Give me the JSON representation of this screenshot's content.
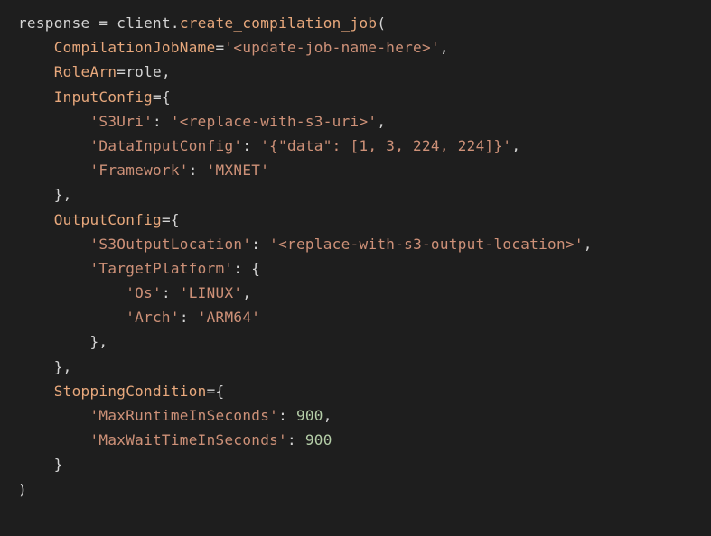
{
  "tokens": {
    "l1_var": "response ",
    "l1_eq": "= ",
    "l1_obj": "client",
    "l1_dot": ".",
    "l1_func": "create_compilation_job",
    "l1_paren": "(",
    "l2_indent": "    ",
    "l2_param": "CompilationJobName",
    "l2_eq": "=",
    "l2_val": "'<update-job-name-here>'",
    "l2_comma": ",",
    "l3_indent": "    ",
    "l3_param": "RoleArn",
    "l3_eq": "=",
    "l3_val": "role",
    "l3_comma": ",",
    "l4_indent": "    ",
    "l4_param": "InputConfig",
    "l4_eq": "=",
    "l4_brace": "{",
    "l5_indent": "        ",
    "l5_key": "'S3Uri'",
    "l5_colon": ": ",
    "l5_val": "'<replace-with-s3-uri>'",
    "l5_comma": ",",
    "l6_indent": "        ",
    "l6_key": "'DataInputConfig'",
    "l6_colon": ": ",
    "l6_val": "'{\"data\": [1, 3, 224, 224]}'",
    "l6_comma": ",",
    "l7_indent": "        ",
    "l7_key": "'Framework'",
    "l7_colon": ": ",
    "l7_val": "'MXNET'",
    "l8_indent": "    ",
    "l8_close": "},",
    "l9_indent": "    ",
    "l9_param": "OutputConfig",
    "l9_eq": "=",
    "l9_brace": "{",
    "l10_indent": "        ",
    "l10_key": "'S3OutputLocation'",
    "l10_colon": ": ",
    "l10_val": "'<replace-with-s3-output-location>'",
    "l10_comma": ",",
    "l11_indent": "        ",
    "l11_key": "'TargetPlatform'",
    "l11_colon": ": ",
    "l11_brace": "{",
    "l12_indent": "            ",
    "l12_key": "'Os'",
    "l12_colon": ": ",
    "l12_val": "'LINUX'",
    "l12_comma": ",",
    "l13_indent": "            ",
    "l13_key": "'Arch'",
    "l13_colon": ": ",
    "l13_val": "'ARM64'",
    "l14_indent": "        ",
    "l14_close": "},",
    "l15_indent": "    ",
    "l15_close": "},",
    "l16_indent": "    ",
    "l16_param": "StoppingCondition",
    "l16_eq": "=",
    "l16_brace": "{",
    "l17_indent": "        ",
    "l17_key": "'MaxRuntimeInSeconds'",
    "l17_colon": ": ",
    "l17_val": "900",
    "l17_comma": ",",
    "l18_indent": "        ",
    "l18_key": "'MaxWaitTimeInSeconds'",
    "l18_colon": ": ",
    "l18_val": "900",
    "l19_indent": "    ",
    "l19_close": "}",
    "l20_close": ")"
  }
}
